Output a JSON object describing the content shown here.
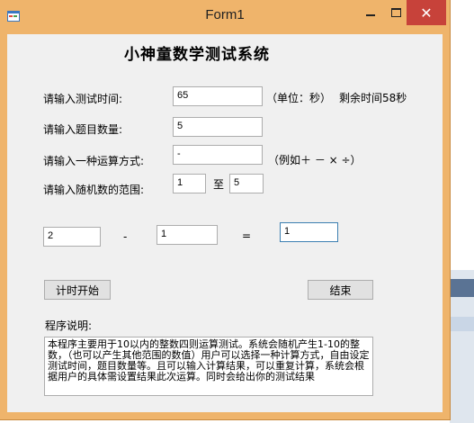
{
  "window": {
    "title": "Form1",
    "close_glyph": "✕"
  },
  "form": {
    "heading": "小神童数学测试系统",
    "time_label": "请输入测试时间:",
    "time_value": "65",
    "unit_text": "（单位：秒）",
    "remaining_text": "剩余时间58秒",
    "count_label": "请输入题目数量:",
    "count_value": "5",
    "op_label": "请输入一种运算方式:",
    "op_value": "-",
    "op_example": "（例如＋ － × ÷）",
    "range_label": "请输入随机数的范围:",
    "range_min": "1",
    "range_to": "至",
    "range_max": "5"
  },
  "question": {
    "operand1": "2",
    "operator": "-",
    "operand2": "1",
    "equals": "=",
    "answer": "1"
  },
  "buttons": {
    "start": "计时开始",
    "end": "结束"
  },
  "description": {
    "label": "程序说明:",
    "text": "本程序主要用于10以内的整数四则运算测试。系统会随机产生1-10的整数，（也可以产生其他范围的数值）用户可以选择一种计算方式，自由设定测试时间，题目数量等。且可以输入计算结果，可以重复计算，系统会根据用户的具体需设置结果此次运算。同时会给出你的测试结果"
  },
  "icons": {
    "app": "app-icon",
    "minimize": "minimize-icon",
    "maximize": "maximize-icon",
    "close": "close-icon"
  }
}
